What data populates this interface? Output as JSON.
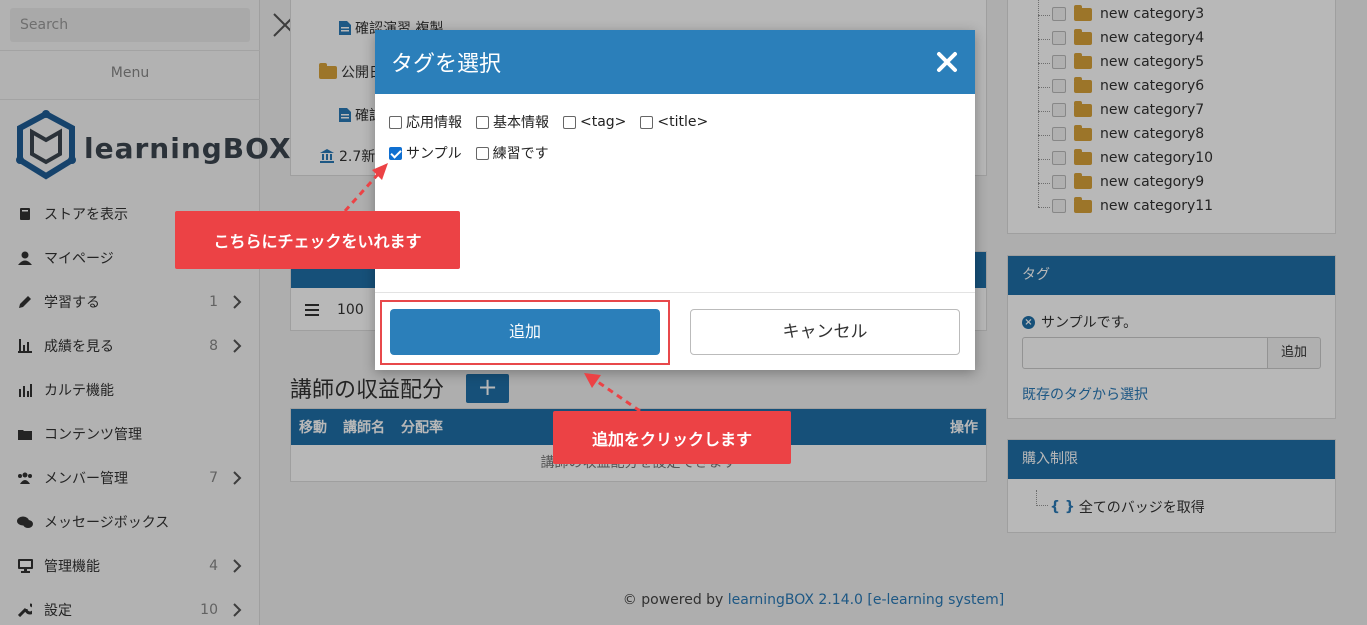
{
  "sidebar": {
    "search_placeholder": "Search",
    "menu_label": "Menu",
    "logo_text": "learningBOX",
    "items": [
      {
        "label": "ストアを表示",
        "count": "",
        "icon": "book-icon"
      },
      {
        "label": "マイページ",
        "count": "",
        "icon": "user-icon"
      },
      {
        "label": "学習する",
        "count": "1",
        "icon": "pencil-icon"
      },
      {
        "label": "成績を見る",
        "count": "8",
        "icon": "bar-chart-icon"
      },
      {
        "label": "カルテ機能",
        "count": "",
        "icon": "stats-icon"
      },
      {
        "label": "コンテンツ管理",
        "count": "",
        "icon": "folder-icon"
      },
      {
        "label": "メンバー管理",
        "count": "7",
        "icon": "users-icon"
      },
      {
        "label": "メッセージボックス",
        "count": "",
        "icon": "chat-icon"
      },
      {
        "label": "管理機能",
        "count": "4",
        "icon": "monitor-icon"
      },
      {
        "label": "設定",
        "count": "10",
        "icon": "wrench-icon"
      }
    ]
  },
  "main": {
    "tree": {
      "row1": "確認演習 複製",
      "row2": "公開日",
      "row3": "確認",
      "row4": "2.7新"
    },
    "table2_row": {
      "value": "100"
    },
    "profit_heading": "講師の収益配分",
    "profit_add": "+",
    "profit_table": {
      "headers": [
        "移動",
        "講師名",
        "分配率"
      ],
      "op_header": "操作",
      "empty_text": "講師の収益配分を設定できます"
    },
    "footer": {
      "prefix": "© powered by ",
      "link": "learningBOX 2.14.0 [e-learning system]"
    }
  },
  "right": {
    "categories": [
      "new category3",
      "new category4",
      "new category5",
      "new category6",
      "new category7",
      "new category8",
      "new category10",
      "new category9",
      "new category11"
    ],
    "tag_panel": {
      "title": "タグ",
      "existing_tag": "サンプルです。",
      "add_label": "追加",
      "select_link": "既存のタグから選択"
    },
    "purchase_panel": {
      "title": "購入制限",
      "item": "全てのバッジを取得",
      "brace": "{ }"
    }
  },
  "modal": {
    "title": "タグを選択",
    "close_label": "×",
    "tags_row1": [
      {
        "label": "応用情報",
        "checked": false
      },
      {
        "label": "基本情報",
        "checked": false
      },
      {
        "label": "<tag>",
        "checked": false
      },
      {
        "label": "<title>",
        "checked": false
      }
    ],
    "tags_row2": [
      {
        "label": "サンプル",
        "checked": true
      },
      {
        "label": "練習です",
        "checked": false
      }
    ],
    "add_button": "追加",
    "cancel_button": "キャンセル"
  },
  "callouts": {
    "check": "こちらにチェックをいれます",
    "add": "追加をクリックします"
  },
  "colors": {
    "primary": "#2b7fba",
    "header_blue": "#1f6fa8",
    "callout_red": "#ec4245",
    "folder": "#d9a33a"
  }
}
